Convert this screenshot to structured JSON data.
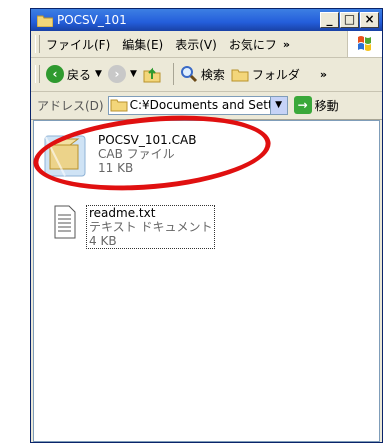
{
  "window": {
    "title": "POCSV_101"
  },
  "caption_buttons": [
    "_",
    "□",
    "×"
  ],
  "menu": {
    "items": [
      "ファイル(F)",
      "編集(E)",
      "表示(V)",
      "お気にフ"
    ],
    "overflow": "»"
  },
  "toolbar": {
    "back": "戻る",
    "search": "検索",
    "folders": "フォルダ",
    "overflow": "»"
  },
  "address": {
    "label": "アドレス(D)",
    "value": "C:¥Documents and Setti",
    "go": "移動"
  },
  "files": [
    {
      "name": "POCSV_101.CAB",
      "type": "CAB ファイル",
      "size": "11 KB"
    },
    {
      "name": "readme.txt",
      "type": "テキスト ドキュメント",
      "size": "4 KB"
    }
  ],
  "colors": {
    "titlebar": "#245edb",
    "annotation": "#e01010",
    "accent_green": "#3aa83a"
  }
}
